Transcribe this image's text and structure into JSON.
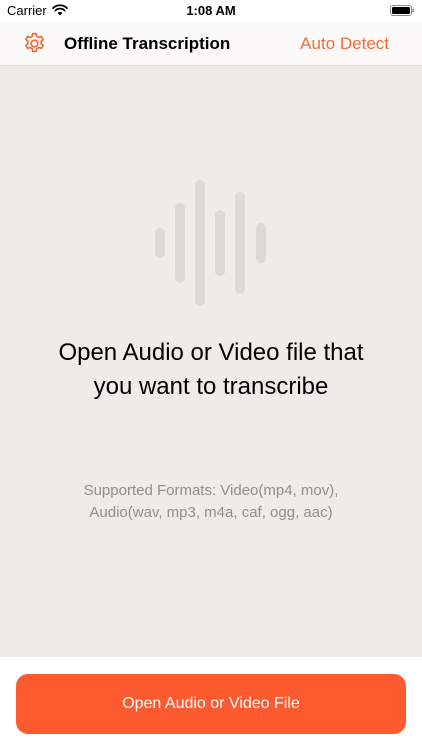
{
  "status_bar": {
    "carrier": "Carrier",
    "time": "1:08 AM"
  },
  "nav": {
    "title": "Offline Transcription",
    "auto_detect_label": "Auto Detect",
    "settings_icon": "gear-icon"
  },
  "empty_state": {
    "icon": "waveform-icon",
    "title": "Open Audio or Video file that you want to transcribe",
    "subtitle": "Supported Formats: Video(mp4, mov), Audio(wav, mp3, m4a, caf, ogg, aac)"
  },
  "bottom": {
    "open_button_label": "Open Audio or Video File"
  },
  "colors": {
    "accent": "#f26b3c",
    "button": "#fe5a2f",
    "background": "#efece7",
    "waveform": "#dcdad6"
  }
}
